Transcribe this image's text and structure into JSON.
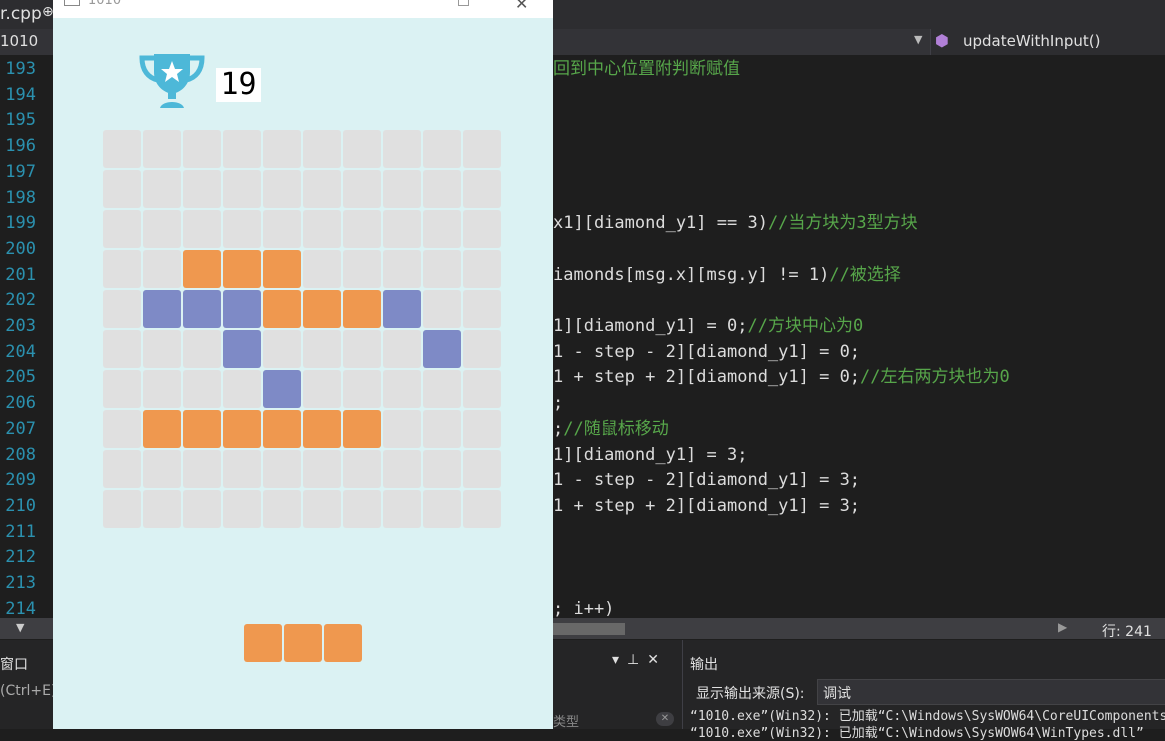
{
  "ide": {
    "file_tab": "r.cpp",
    "tab_pin_glyph": "⊕",
    "nav_left": "1010",
    "member_dropdown": "updateWithInput()",
    "status_line": "行: 241",
    "line_numbers": [
      "193",
      "194",
      "195",
      "196",
      "197",
      "198",
      "199",
      "200",
      "201",
      "202",
      "203",
      "204",
      "205",
      "206",
      "207",
      "208",
      "209",
      "210",
      "211",
      "212",
      "213",
      "214"
    ],
    "code_lines": [
      {
        "code": "",
        "comment": "回到中心位置附判断赋值"
      },
      {
        "code": "",
        "comment": ""
      },
      {
        "code": "",
        "comment": ""
      },
      {
        "code": "",
        "comment": ""
      },
      {
        "code": "",
        "comment": ""
      },
      {
        "code": "",
        "comment": ""
      },
      {
        "code": "x1][diamond_y1] == 3)",
        "comment": "//当方块为3型方块"
      },
      {
        "code": "",
        "comment": ""
      },
      {
        "code": "iamonds[msg.x][msg.y] != 1)",
        "comment": "//被选择"
      },
      {
        "code": "",
        "comment": ""
      },
      {
        "code": "1][diamond_y1] = 0;",
        "comment": "//方块中心为0"
      },
      {
        "code": "1 - step - 2][diamond_y1] = 0;",
        "comment": ""
      },
      {
        "code": "1 + step + 2][diamond_y1] = 0;",
        "comment": "//左右两方块也为0"
      },
      {
        "code": ";",
        "comment": ""
      },
      {
        "code": ";",
        "comment": "//随鼠标移动"
      },
      {
        "code": "1][diamond_y1] = 3;",
        "comment": ""
      },
      {
        "code": "1 - step - 2][diamond_y1] = 3;",
        "comment": ""
      },
      {
        "code": "1 + step + 2][diamond_y1] = 3;",
        "comment": ""
      },
      {
        "code": "",
        "comment": ""
      },
      {
        "code": "",
        "comment": ""
      },
      {
        "code": "",
        "comment": ""
      },
      {
        "code": "; i++)",
        "comment": ""
      }
    ],
    "left_panel": {
      "title": "窗口",
      "hint": "(Ctrl+E)",
      "type_label": "类型"
    },
    "output": {
      "title": "输出",
      "source_label": "显示输出来源(S):",
      "source_value": "调试",
      "lines": [
        "“1010.exe”(Win32): 已加载“C:\\Windows\\SysWOW64\\CoreUIComponents.dll”",
        "“1010.exe”(Win32): 已加载“C:\\Windows\\SysWOW64\\WinTypes.dll”"
      ]
    }
  },
  "game": {
    "window_title": "1010",
    "score": "19",
    "grid_size": 10,
    "colors": {
      "empty": "#e0e0e0",
      "orange": "#ef984f",
      "blue": "#7e8ac6",
      "background": "#dbf2f3",
      "trophy": "#4db8d8"
    },
    "board": [
      "..........",
      "..........",
      "..........",
      "..ooo.....",
      ".bbbooob..",
      "...b....b.",
      "....b.....",
      ".oooooo...",
      "..........",
      ".........."
    ],
    "piece": "ooo"
  }
}
